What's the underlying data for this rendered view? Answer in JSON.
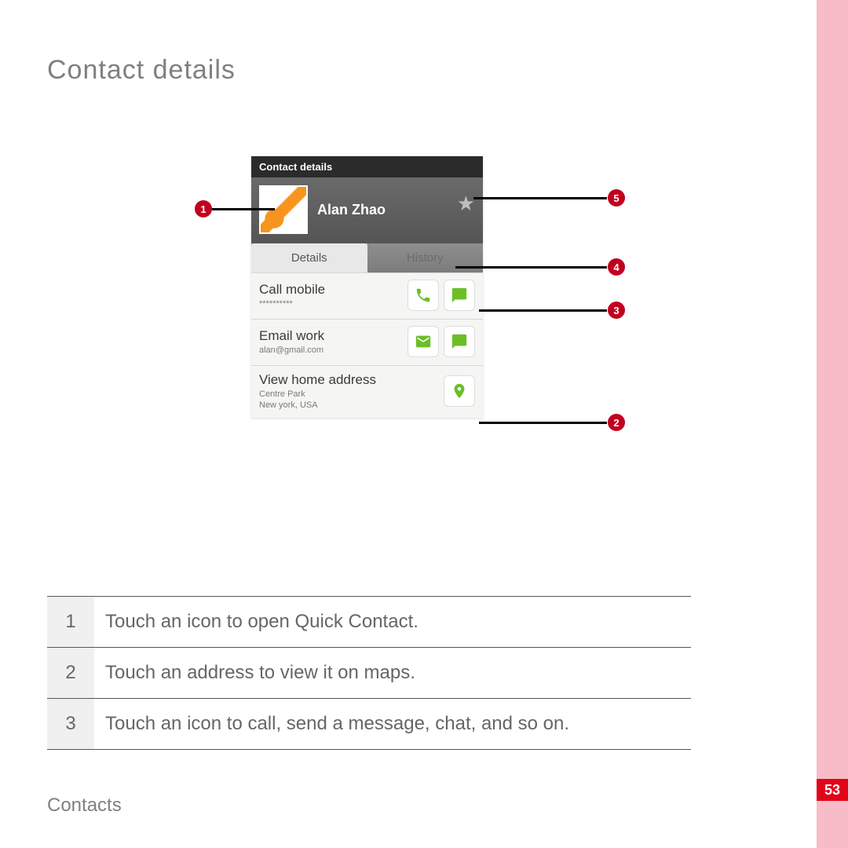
{
  "page": {
    "heading": "Contact details",
    "footer": "Contacts",
    "number": "53"
  },
  "phone": {
    "titlebar": "Contact details",
    "contact_name": "Alan Zhao",
    "tabs": {
      "details": "Details",
      "history": "History"
    },
    "rows": {
      "call": {
        "title": "Call mobile",
        "sub": "**********"
      },
      "email": {
        "title": "Email work",
        "sub": "alan@gmail.com"
      },
      "address": {
        "title": "View home address",
        "sub1": "Centre Park",
        "sub2": "New york, USA"
      }
    }
  },
  "callouts": {
    "c1": "1",
    "c2": "2",
    "c3": "3",
    "c4": "4",
    "c5": "5"
  },
  "legend": [
    {
      "num": "1",
      "text": "Touch an icon to open Quick Contact."
    },
    {
      "num": "2",
      "text": "Touch an address to view it on maps."
    },
    {
      "num": "3",
      "text": "Touch an icon to call, send a message, chat, and so on."
    }
  ]
}
